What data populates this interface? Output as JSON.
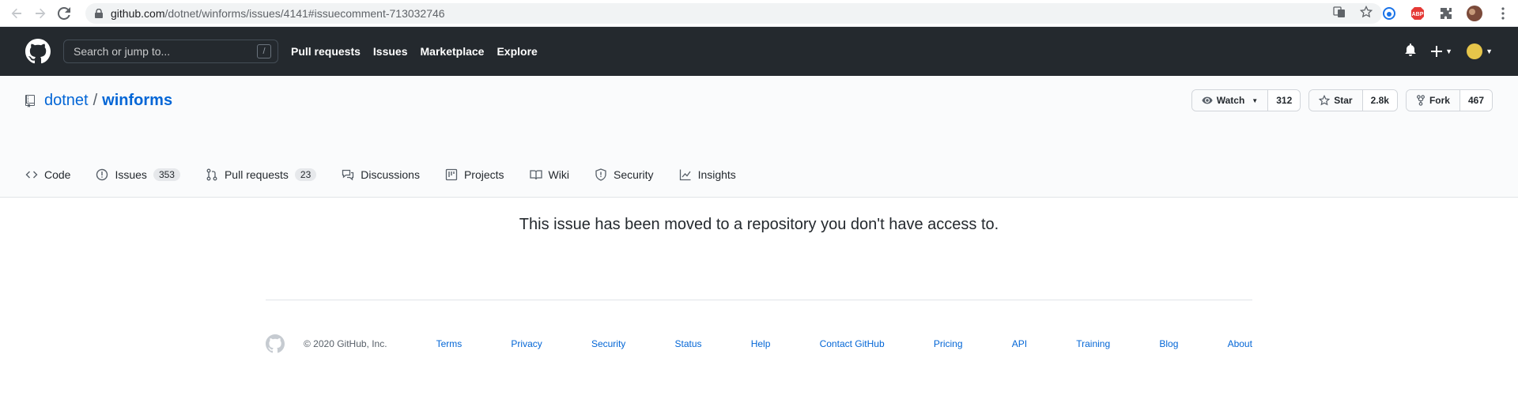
{
  "browser": {
    "url_host": "github.com",
    "url_path": "/dotnet/winforms/issues/4141#issuecomment-713032746"
  },
  "header": {
    "search_placeholder": "Search or jump to...",
    "search_shortcut": "/",
    "nav": [
      "Pull requests",
      "Issues",
      "Marketplace",
      "Explore"
    ]
  },
  "repo": {
    "owner": "dotnet",
    "separator": "/",
    "name": "winforms",
    "watch_label": "Watch",
    "watch_count": "312",
    "star_label": "Star",
    "star_count": "2.8k",
    "fork_label": "Fork",
    "fork_count": "467"
  },
  "tabs": [
    {
      "label": "Code",
      "icon": "code-icon"
    },
    {
      "label": "Issues",
      "icon": "issue-icon",
      "count": "353"
    },
    {
      "label": "Pull requests",
      "icon": "pull-request-icon",
      "count": "23"
    },
    {
      "label": "Discussions",
      "icon": "discussion-icon"
    },
    {
      "label": "Projects",
      "icon": "project-icon"
    },
    {
      "label": "Wiki",
      "icon": "book-icon"
    },
    {
      "label": "Security",
      "icon": "shield-icon"
    },
    {
      "label": "Insights",
      "icon": "graph-icon"
    }
  ],
  "message": "This issue has been moved to a repository you don't have access to.",
  "footer": {
    "copyright": "© 2020 GitHub, Inc.",
    "links": [
      "Terms",
      "Privacy",
      "Security",
      "Status",
      "Help",
      "Contact GitHub",
      "Pricing",
      "API",
      "Training",
      "Blog",
      "About"
    ]
  },
  "colors": {
    "header_bg": "#24292e",
    "link": "#0366d6",
    "repohead_bg": "#fafbfc"
  }
}
